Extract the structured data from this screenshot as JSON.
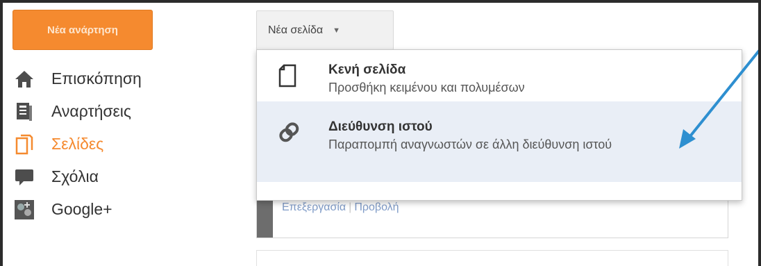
{
  "sidebar": {
    "new_post_label": "Νέα ανάρτηση",
    "items": [
      {
        "label": "Επισκόπηση",
        "icon": "home-icon"
      },
      {
        "label": "Αναρτήσεις",
        "icon": "posts-icon"
      },
      {
        "label": "Σελίδες",
        "icon": "pages-icon",
        "active": true
      },
      {
        "label": "Σχόλια",
        "icon": "comments-icon"
      },
      {
        "label": "Google+",
        "icon": "google-plus-icon"
      }
    ]
  },
  "toolbar": {
    "new_page_label": "Νέα σελίδα",
    "caret": "▼"
  },
  "menu": {
    "items": [
      {
        "title": "Κενή σελίδα",
        "subtitle": "Προσθήκη κειμένου και πολυμέσων",
        "icon": "blank-page-icon"
      },
      {
        "title": "Διεύθυνση ιστού",
        "subtitle": "Παραπομπή αναγνωστών σε άλλη διεύθυνση ιστού",
        "icon": "link-icon"
      }
    ]
  },
  "page_card": {
    "edit_label": "Επεξεργασία",
    "separator": "|",
    "view_label": "Προβολή"
  },
  "colors": {
    "accent": "#f58a2f",
    "link": "#7f9bc7",
    "highlight": "#e9eef6",
    "annotation_arrow": "#2e8fd0"
  }
}
